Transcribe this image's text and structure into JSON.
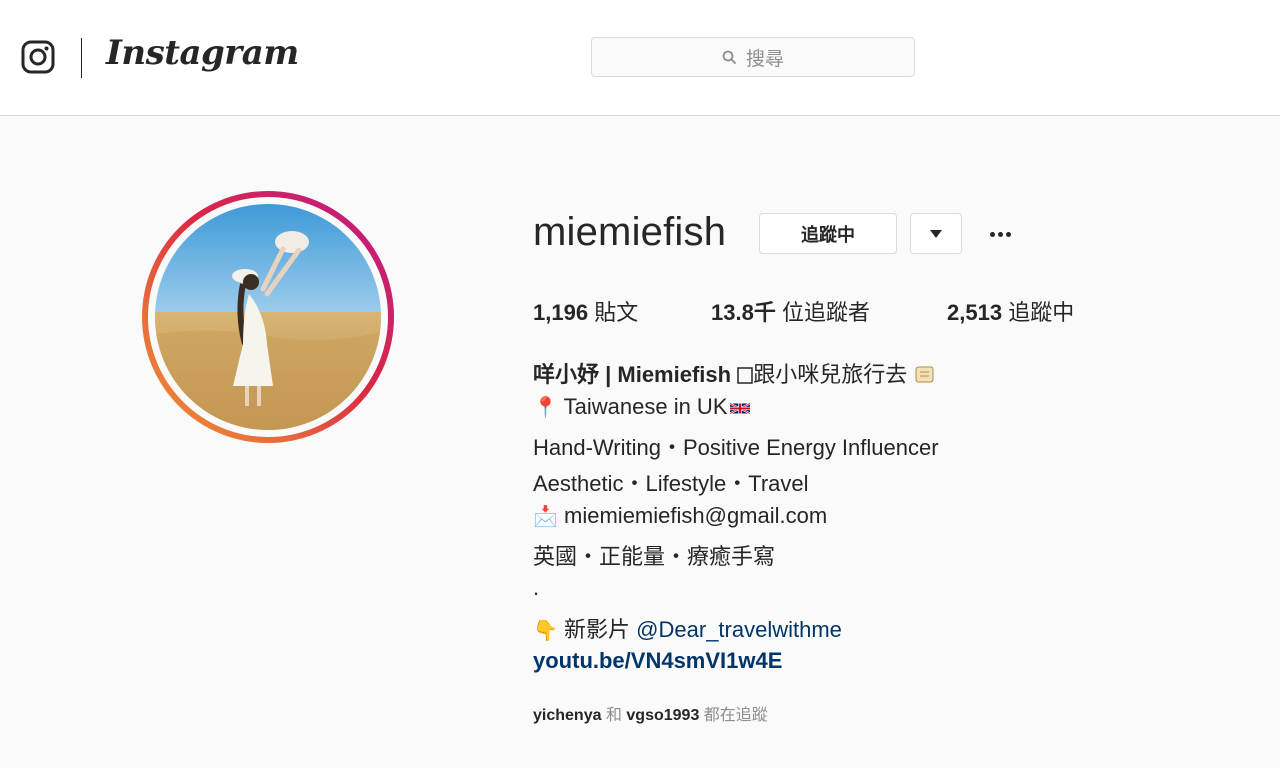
{
  "header": {
    "wordmark": "Instagram",
    "search_placeholder": "搜尋"
  },
  "profile": {
    "username": "miemiefish",
    "following_button": "追蹤中",
    "stats": {
      "posts_count": "1,196",
      "posts_label": "貼文",
      "followers_count": "13.8千",
      "followers_label": "位追蹤者",
      "following_count": "2,513",
      "following_label": "追蹤中"
    },
    "bio": {
      "name": "咩小妤 | Miemiefish",
      "name_tail": "跟小咪兒旅行去",
      "pin_emoji": "📍",
      "location": "Taiwanese in UK",
      "line3": "Hand-Writing・Positive Energy Influencer",
      "line4": "Aesthetic・Lifestyle・Travel",
      "mail_emoji": "📩",
      "email": "miemiemiefish@gmail.com",
      "line6": "英國・正能量・療癒手寫",
      "line7": ".",
      "hand_emoji": "👇",
      "video_label": "新影片",
      "mention": "@Dear_travelwithme",
      "link": "youtu.be/VN4smVI1w4E"
    },
    "followed_by": {
      "user1": "yichenya",
      "conj": "和",
      "user2": "vgso1993",
      "suffix": "都在追蹤"
    }
  },
  "colors": {
    "link": "#003569",
    "border": "#dbdbdb",
    "muted": "#8e8e8e",
    "text": "#262626"
  },
  "icons": {
    "logo": "instagram-camera-icon",
    "search": "search-icon",
    "dropdown": "caret-down-icon",
    "more": "ellipsis-icon",
    "flag": "uk-flag-icon"
  }
}
